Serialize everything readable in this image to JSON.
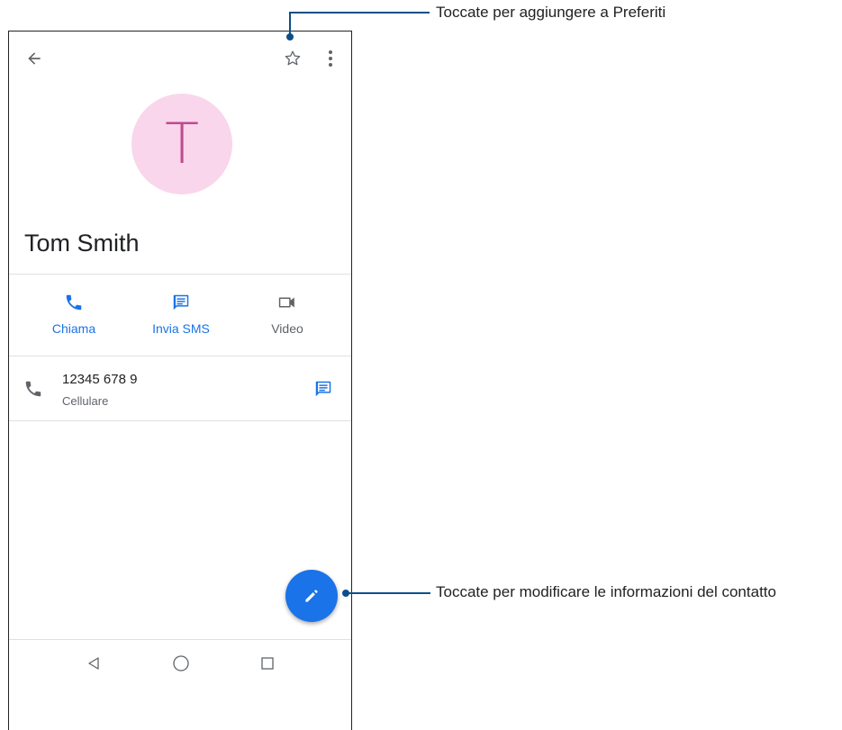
{
  "contact": {
    "avatar_letter": "T",
    "name": "Tom Smith",
    "avatar_color": "#f9d6eb",
    "avatar_letter_color": "#bf4a8f"
  },
  "actions": [
    {
      "label": "Chiama",
      "icon": "phone-icon"
    },
    {
      "label": "Invia SMS",
      "icon": "message-icon"
    },
    {
      "label": "Video",
      "icon": "video-icon"
    }
  ],
  "phone_entry": {
    "number": "12345 678 9",
    "type": "Cellulare"
  },
  "callouts": {
    "favorite": "Toccate per aggiungere a Preferiti",
    "edit": "Toccate per modificare le informazioni del contatto"
  },
  "colors": {
    "accent": "#1a73e8",
    "callout": "#0b4f8a"
  }
}
